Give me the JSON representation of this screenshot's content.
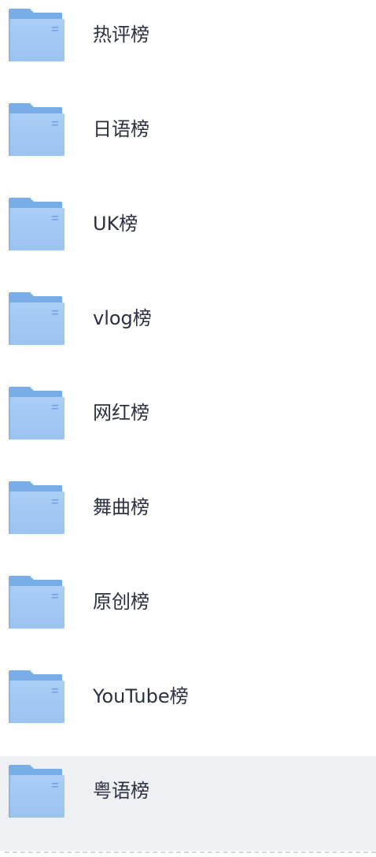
{
  "colors": {
    "folder_back": "#77aee8",
    "folder_front_top": "#a9cdf5",
    "folder_front_bottom": "#9cc4f0",
    "folder_mark": "#6fa2dc",
    "text": "#2b3142",
    "selected_row_bg": "#eef0f2",
    "divider": "#d4d7dc"
  },
  "icons": {
    "folder": "folder-icon"
  },
  "selected_index": 8,
  "items": [
    {
      "label": "热评榜"
    },
    {
      "label": "日语榜"
    },
    {
      "label": "UK榜"
    },
    {
      "label": "vlog榜"
    },
    {
      "label": "网红榜"
    },
    {
      "label": "舞曲榜"
    },
    {
      "label": "原创榜"
    },
    {
      "label": "YouTube榜"
    },
    {
      "label": "粤语榜"
    }
  ]
}
